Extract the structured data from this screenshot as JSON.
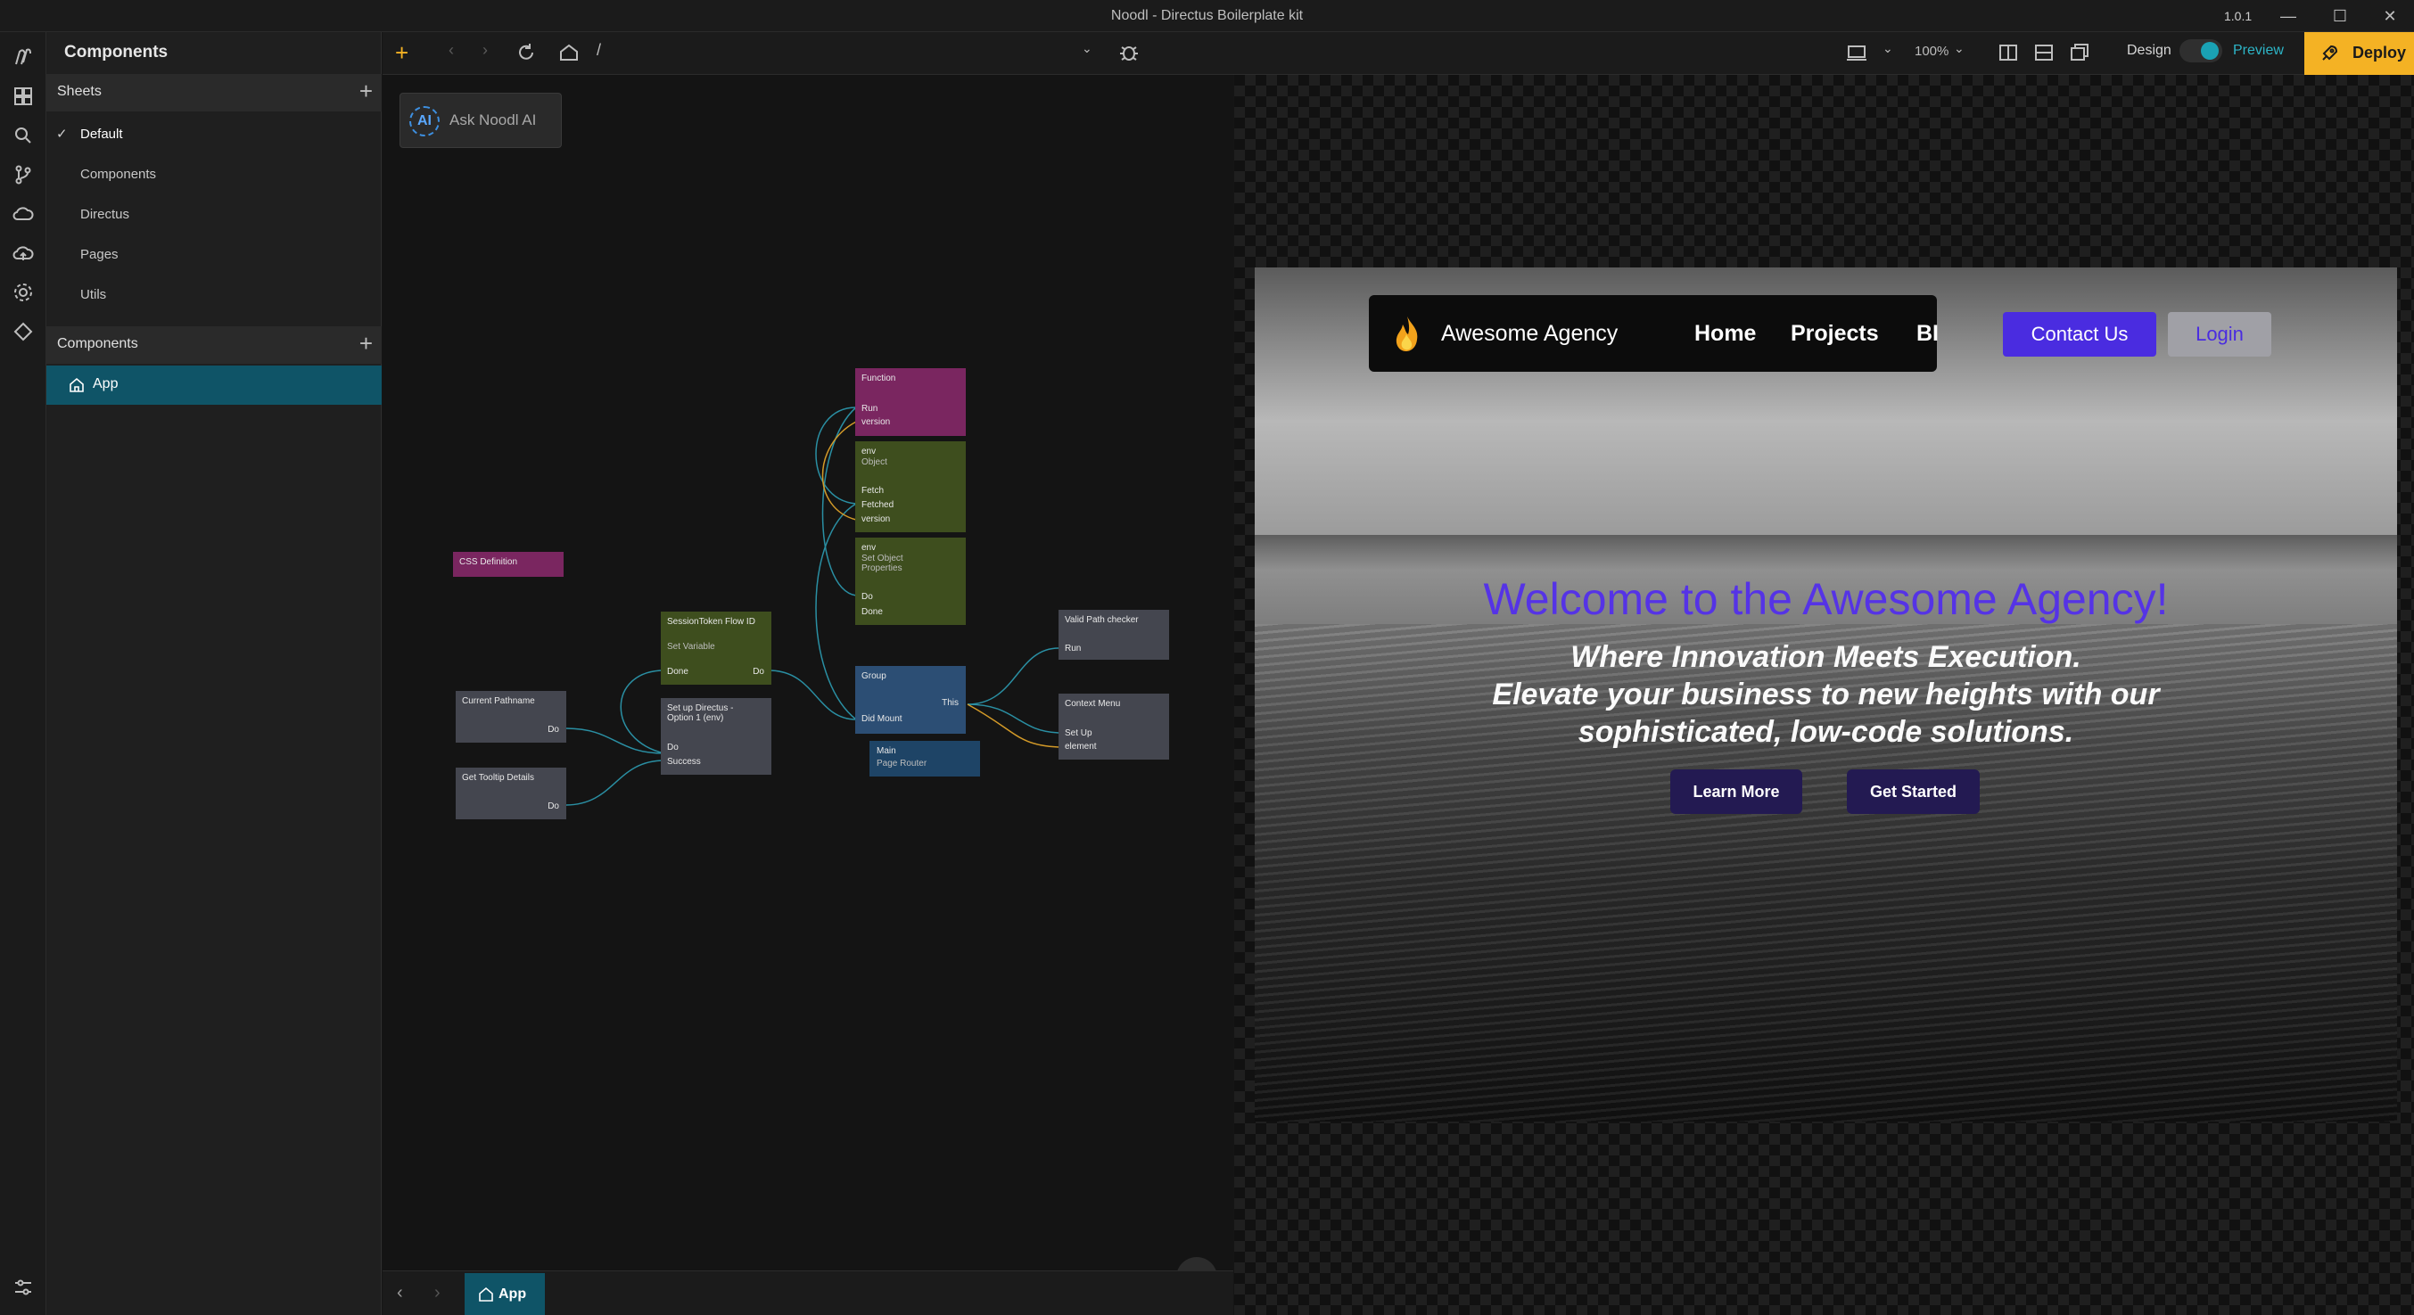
{
  "window": {
    "title": "Noodl - Directus Boilerplate kit",
    "version": "1.0.1"
  },
  "rail": {
    "icons": [
      "noodl-logo-icon",
      "components-icon",
      "search-icon",
      "branch-icon",
      "cloud-icon",
      "cloud-deploy-icon",
      "settings-icon",
      "diamond-icon",
      "sliders-icon"
    ]
  },
  "sidebar": {
    "title": "Components",
    "sheets_label": "Sheets",
    "sheets": [
      "Default",
      "Components",
      "Directus",
      "Pages",
      "Utils"
    ],
    "components_label": "Components",
    "components": [
      "App"
    ]
  },
  "toolbar": {
    "path": "/",
    "zoom": "100%",
    "design_label": "Design",
    "preview_label": "Preview",
    "deploy_label": "Deploy"
  },
  "canvas": {
    "ask_ai_badge": "AI",
    "ask_ai_label": "Ask Noodl AI",
    "help": "?"
  },
  "nodes": {
    "css_def": "CSS Definition",
    "current_pathname": {
      "title": "Current Pathname",
      "port": "Do"
    },
    "get_tooltip": {
      "title": "Get Tooltip Details",
      "port": "Do"
    },
    "session_token": {
      "title": "SessionToken Flow ID",
      "sub": "Set Variable",
      "left": "Done",
      "right": "Do"
    },
    "setup_directus": {
      "title": "Set up Directus - Option 1 (env)",
      "p1": "Do",
      "p2": "Success"
    },
    "function": {
      "title": "Function",
      "p1": "Run",
      "p2": "version"
    },
    "env_object": {
      "title": "env",
      "sub": "Object",
      "p1": "Fetch",
      "p2": "Fetched",
      "p3": "version"
    },
    "env_set": {
      "title": "env",
      "sub": "Set Object Properties",
      "p1": "Do",
      "p2": "Done"
    },
    "group": {
      "title": "Group",
      "right": "This",
      "left": "Did Mount"
    },
    "main": {
      "title": "Main",
      "sub": "Page Router"
    },
    "valid_path": {
      "title": "Valid Path checker",
      "port": "Run"
    },
    "context_menu": {
      "title": "Context Menu",
      "p1": "Set Up",
      "p2": "element"
    }
  },
  "bottombar": {
    "tab": "App"
  },
  "site": {
    "brand": "Awesome Agency",
    "nav": [
      "Home",
      "Projects",
      "BI"
    ],
    "contact": "Contact Us",
    "login": "Login",
    "hero_title": "Welcome to the Awesome Agency!",
    "hero_sub_1": "Where Innovation Meets Execution.",
    "hero_sub_2": "Elevate your business to new heights with our",
    "hero_sub_3": "sophisticated, low-code solutions.",
    "learn_more": "Learn More",
    "get_started": "Get Started"
  },
  "colors": {
    "accent": "#0f5467",
    "deploy": "#f4b224",
    "brand_purple": "#5533e6",
    "button_purple": "#4a2ce0"
  }
}
